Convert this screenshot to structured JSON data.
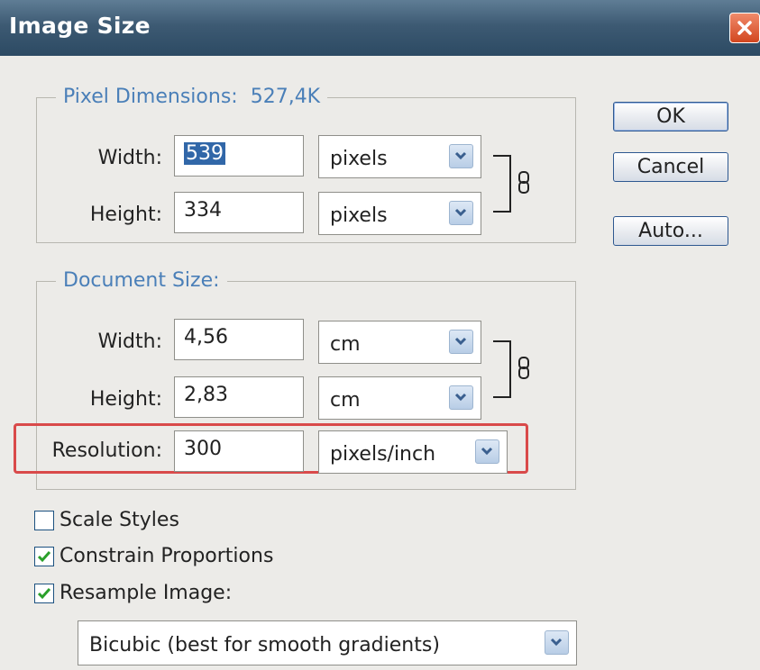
{
  "window": {
    "title": "Image Size"
  },
  "pixel_dimensions": {
    "legend": "Pixel Dimensions:",
    "size": "527,4K",
    "width_label": "Width:",
    "width_value": "539",
    "width_unit": "pixels",
    "height_label": "Height:",
    "height_value": "334",
    "height_unit": "pixels"
  },
  "document_size": {
    "legend": "Document Size:",
    "width_label": "Width:",
    "width_value": "4,56",
    "width_unit": "cm",
    "height_label": "Height:",
    "height_value": "2,83",
    "height_unit": "cm",
    "resolution_label": "Resolution:",
    "resolution_value": "300",
    "resolution_unit": "pixels/inch"
  },
  "buttons": {
    "ok": "OK",
    "cancel": "Cancel",
    "auto": "Auto..."
  },
  "options": {
    "scale_styles": {
      "label": "Scale Styles",
      "checked": false
    },
    "constrain": {
      "label": "Constrain Proportions",
      "checked": true
    },
    "resample": {
      "label": "Resample Image:",
      "checked": true
    },
    "resample_method": "Bicubic (best for smooth gradients)"
  },
  "colors": {
    "highlight": "#d94a4a",
    "legend": "#4a7fb8",
    "titlebar": "#3d5a73"
  }
}
